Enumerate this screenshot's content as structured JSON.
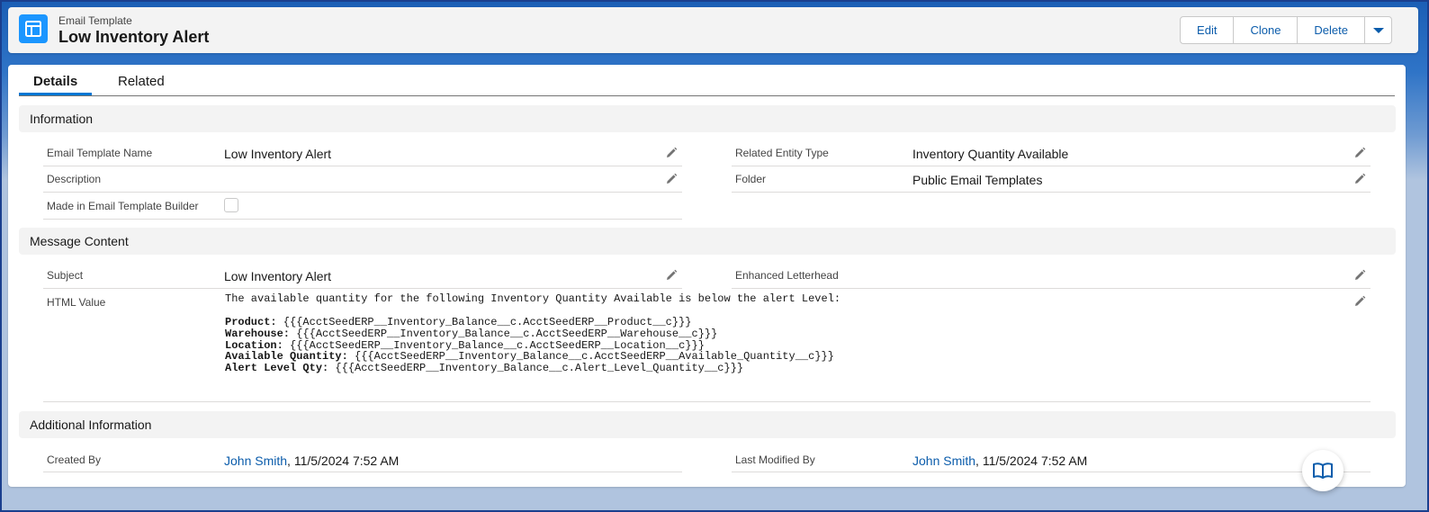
{
  "header": {
    "entity_label": "Email Template",
    "title": "Low Inventory Alert",
    "actions": {
      "edit": "Edit",
      "clone": "Clone",
      "delete": "Delete"
    }
  },
  "tabs": {
    "details": "Details",
    "related": "Related"
  },
  "sections": {
    "information": "Information",
    "message_content": "Message Content",
    "additional_information": "Additional Information"
  },
  "information": {
    "template_name_label": "Email Template Name",
    "template_name_value": "Low Inventory Alert",
    "description_label": "Description",
    "description_value": "",
    "made_in_builder_label": "Made in Email Template Builder",
    "made_in_builder_checked": false,
    "related_entity_label": "Related Entity Type",
    "related_entity_value": "Inventory Quantity Available",
    "folder_label": "Folder",
    "folder_value": "Public Email Templates"
  },
  "message": {
    "subject_label": "Subject",
    "subject_value": "Low Inventory Alert",
    "letterhead_label": "Enhanced Letterhead",
    "html_label": "HTML Value",
    "html_intro": "The available quantity for the following Inventory Quantity Available is below the alert Level:",
    "html_lines": [
      {
        "key": "Product:",
        "value": " {{{AcctSeedERP__Inventory_Balance__c.AcctSeedERP__Product__c}}}"
      },
      {
        "key": "Warehouse:",
        "value": " {{{AcctSeedERP__Inventory_Balance__c.AcctSeedERP__Warehouse__c}}}"
      },
      {
        "key": "Location:",
        "value": " {{{AcctSeedERP__Inventory_Balance__c.AcctSeedERP__Location__c}}}"
      },
      {
        "key": "Available Quantity:",
        "value": " {{{AcctSeedERP__Inventory_Balance__c.AcctSeedERP__Available_Quantity__c}}}"
      },
      {
        "key": "Alert Level Qty:",
        "value": " {{{AcctSeedERP__Inventory_Balance__c.Alert_Level_Quantity__c}}}"
      }
    ]
  },
  "additional": {
    "created_by_label": "Created By",
    "created_by_user": "John Smith",
    "created_by_date": ", 11/5/2024 7:52 AM",
    "modified_by_label": "Last Modified By",
    "modified_by_user": "John Smith",
    "modified_by_date": ", 11/5/2024 7:52 AM"
  },
  "icons": {
    "app": "email-template-icon",
    "more": "chevron-down-icon",
    "edit": "pencil-icon",
    "help": "book-icon"
  },
  "colors": {
    "brand": "#0176d3",
    "link": "#0b5cab",
    "app_icon": "#1b96ff"
  }
}
